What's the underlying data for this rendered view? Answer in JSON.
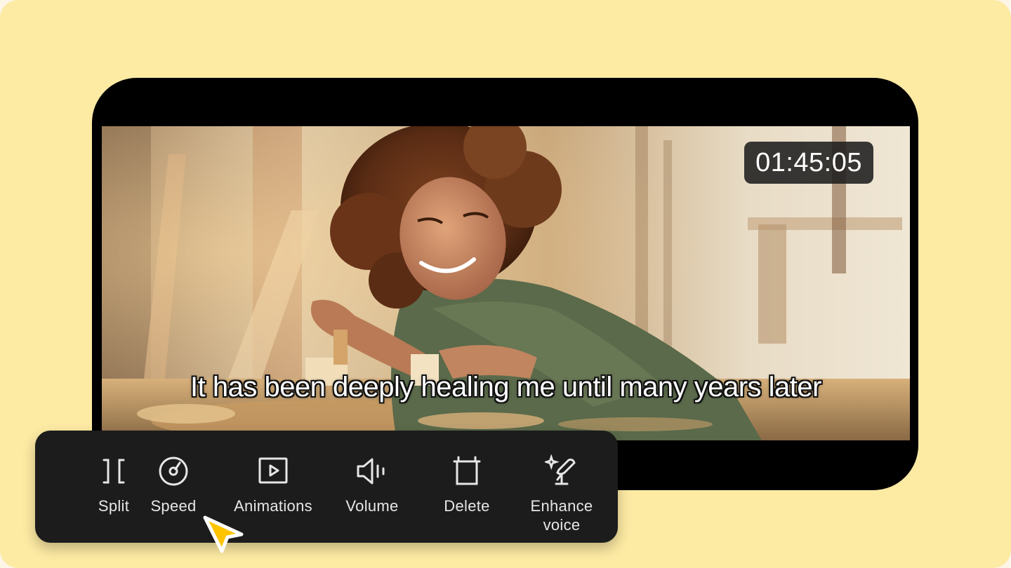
{
  "video": {
    "timecode": "01:45:05",
    "subtitle": "It has been deeply healing me until many years later"
  },
  "toolbar": {
    "items": [
      {
        "label": "Split",
        "icon": "split-icon"
      },
      {
        "label": "Speed",
        "icon": "speed-icon"
      },
      {
        "label": "Animations",
        "icon": "animations-icon"
      },
      {
        "label": "Volume",
        "icon": "volume-icon"
      },
      {
        "label": "Delete",
        "icon": "delete-icon"
      },
      {
        "label": "Enhance\nvoice",
        "icon": "enhance-voice-icon"
      }
    ]
  },
  "colors": {
    "background": "#fdeaa3",
    "device": "#000000",
    "toolbar": "#1c1c1c",
    "cursor": "#ffc400"
  }
}
